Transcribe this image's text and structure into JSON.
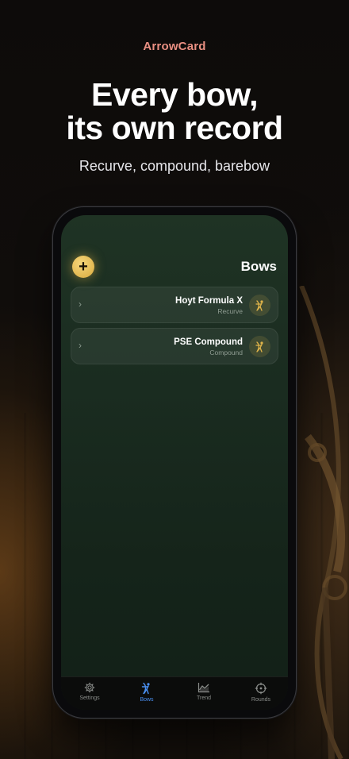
{
  "brand": "ArrowCard",
  "headline": {
    "line1": "Every bow,",
    "line2": "its own record"
  },
  "subhead": "Recurve, compound, barebow",
  "app": {
    "title": "Bows",
    "add_icon": "plus-icon",
    "bows": [
      {
        "name": "Hoyt Formula X",
        "type": "Recurve",
        "icon": "archer-icon"
      },
      {
        "name": "PSE Compound",
        "type": "Compound",
        "icon": "archer-icon"
      }
    ],
    "tabs": [
      {
        "label": "Settings",
        "icon": "gear-icon",
        "active": false
      },
      {
        "label": "Bows",
        "icon": "archer-icon",
        "active": true
      },
      {
        "label": "Trend",
        "icon": "trend-chart-icon",
        "active": false
      },
      {
        "label": "Rounds",
        "icon": "crosshair-icon",
        "active": false
      }
    ]
  },
  "colors": {
    "brand_accent": "#e98f82",
    "gold": "#e0b44a",
    "active_tab": "#4a8ff0",
    "screen_green": "#1a2c20"
  }
}
